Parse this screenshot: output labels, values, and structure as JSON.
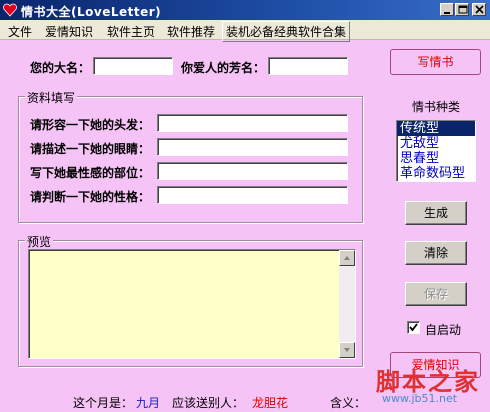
{
  "window": {
    "title": "情书大全(LoveLetter)"
  },
  "menu": {
    "items": [
      "文件",
      "爱情知识",
      "软件主页",
      "软件推荐",
      "装机必备经典软件合集"
    ]
  },
  "form": {
    "your_name_label": "您的大名：",
    "your_name_value": "",
    "lover_name_label": "你爱人的芳名：",
    "lover_name_value": "",
    "group_title": "资料填写",
    "fields": [
      {
        "label": "请形容一下她的头发：",
        "value": ""
      },
      {
        "label": "请描述一下她的眼睛：",
        "value": ""
      },
      {
        "label": "写下她最性感的部位：",
        "value": ""
      },
      {
        "label": "请判断一下她的性格：",
        "value": ""
      }
    ],
    "preview_title": "预览",
    "preview_text": ""
  },
  "right_panel": {
    "write_button": "写情书",
    "type_label": "情书种类",
    "types": [
      "传统型",
      "尤敌型",
      "思春型",
      "革命数码型"
    ],
    "selected_type_index": 0,
    "generate_button": "生成",
    "clear_button": "清除",
    "save_button": "保存",
    "autostart_label": "自启动",
    "autostart_checked": true,
    "knowledge_button": "爱情知识"
  },
  "statusbar": {
    "month_label": "这个月是：",
    "month_value": "九月",
    "gift_label": "应该送别人：",
    "gift_value": "龙胆花",
    "meaning_label": "含义：",
    "meaning_value": ""
  },
  "watermark": {
    "title": "脚本之家",
    "url": "www.jb51.net"
  },
  "colors": {
    "background": "#f6c3f6",
    "title_bar": "#0a246a",
    "accent_red": "#e00000",
    "list_text": "#0000c0",
    "status_value": "#2020c0"
  }
}
